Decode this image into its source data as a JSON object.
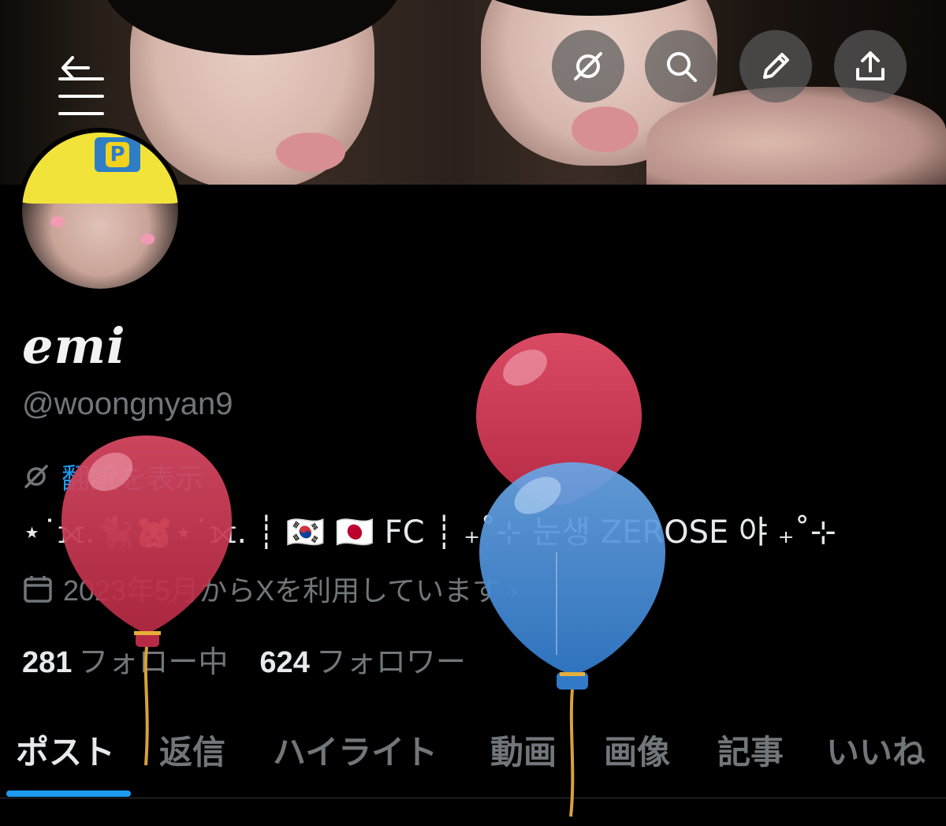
{
  "profile": {
    "display_name": "emi",
    "handle": "@woongnyan9",
    "translate_label": "翻訳を表示",
    "bio": "⋆˙⟗.🐈‍⬛🐹⋆˙⟗.  ┊  🇰🇷 🇯🇵 FC  ┊  ₊˚⊹ 눈생 ZEROSE 야 ₊˚⊹",
    "joined": "2023年5月からXを利用しています ›",
    "following_count": "281",
    "following_label": "フォロー中",
    "followers_count": "624",
    "followers_label": "フォロワー"
  },
  "nav": {
    "back_icon": "arrow-left-icon",
    "grok_icon": "grok-icon",
    "search_icon": "search-icon",
    "edit_icon": "pencil-icon",
    "share_icon": "share-icon"
  },
  "tabs": [
    {
      "label": "ポスト",
      "active": true
    },
    {
      "label": "返信",
      "active": false
    },
    {
      "label": "ハイライト",
      "active": false
    },
    {
      "label": "動画",
      "active": false
    },
    {
      "label": "画像",
      "active": false
    },
    {
      "label": "記事",
      "active": false
    },
    {
      "label": "いいね",
      "active": false
    }
  ],
  "colors": {
    "accent": "#1d9bf0",
    "secondary_text": "#71767b",
    "balloon_red": "#c8324e",
    "balloon_blue": "#3d87d4"
  }
}
